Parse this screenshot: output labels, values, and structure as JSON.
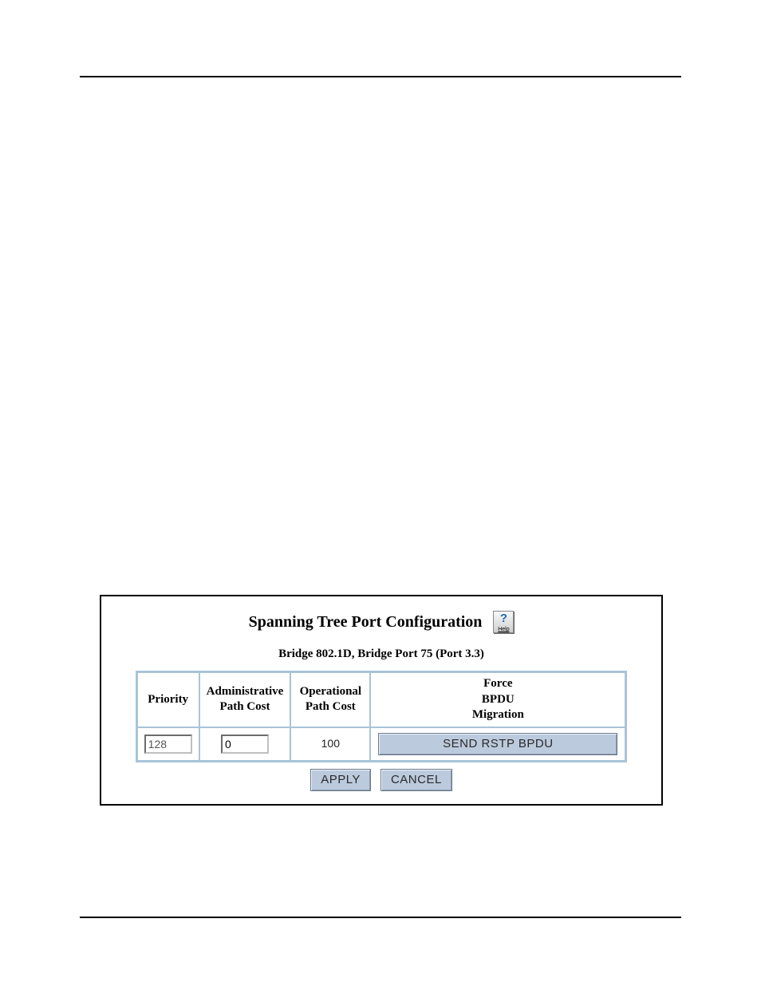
{
  "dialog": {
    "title": "Spanning Tree Port Configuration",
    "help_label": "Help",
    "subtitle": "Bridge 802.1D, Bridge Port 75 (Port 3.3)",
    "headers": {
      "priority": "Priority",
      "admin_line1": "Administrative",
      "admin_line2": "Path Cost",
      "oper_line1": "Operational",
      "oper_line2": "Path Cost",
      "force_line1": "Force",
      "force_line2": "BPDU",
      "force_line3": "Migration"
    },
    "row": {
      "priority_value": "128",
      "admin_path_cost_value": "0",
      "operational_path_cost": "100",
      "send_button_label": "SEND RSTP BPDU"
    },
    "buttons": {
      "apply": "APPLY",
      "cancel": "CANCEL"
    }
  }
}
